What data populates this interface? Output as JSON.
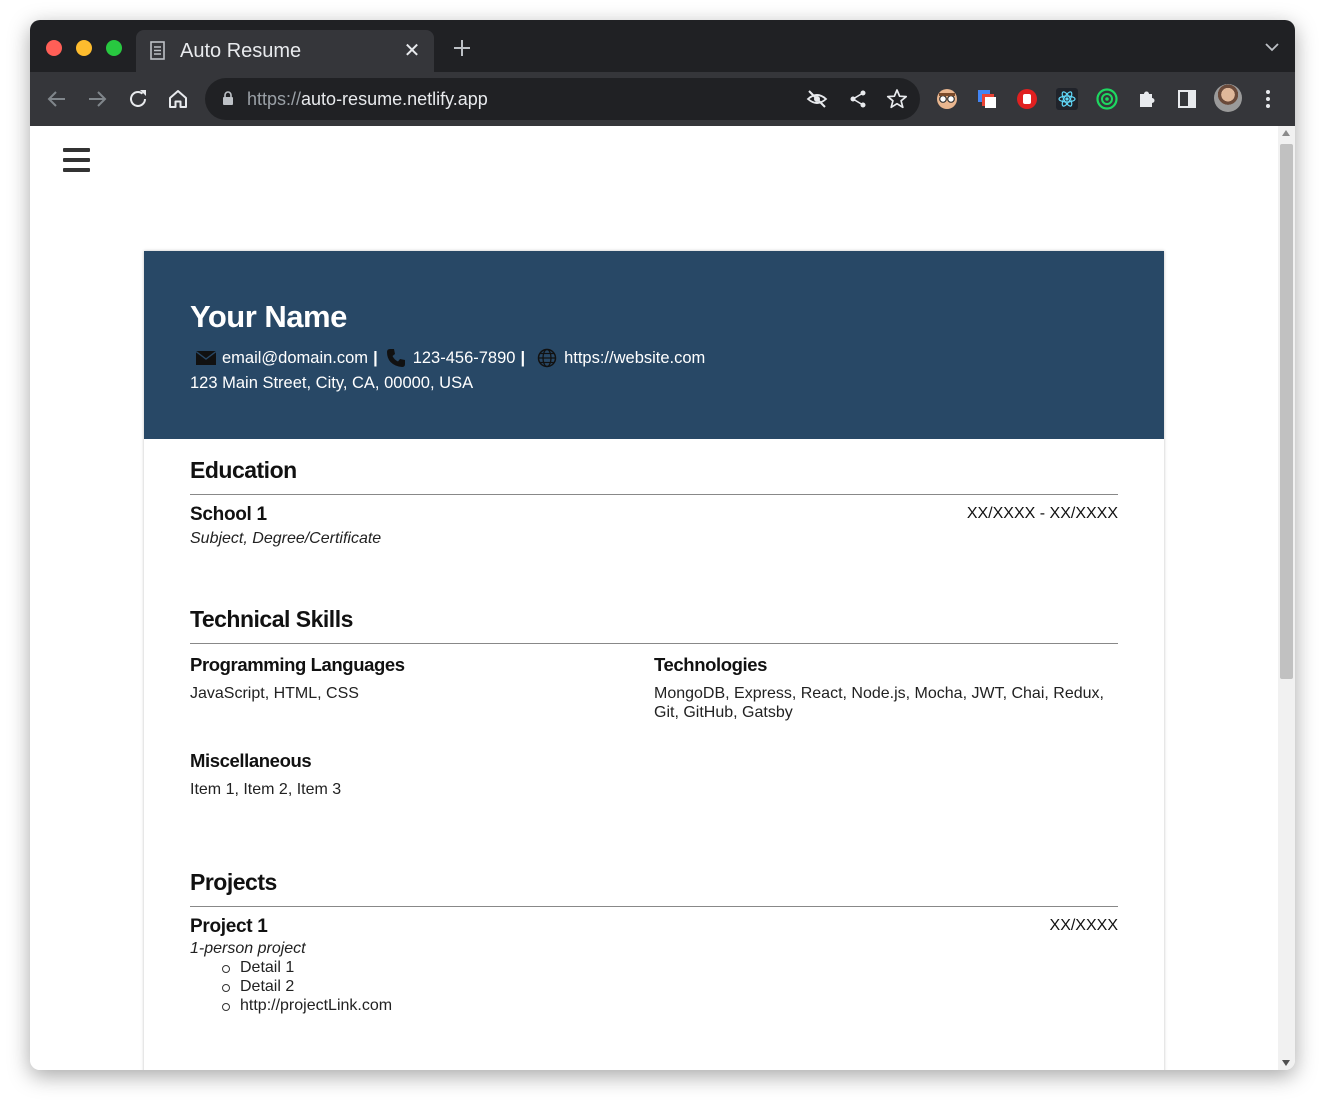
{
  "browser": {
    "tab_title": "Auto Resume",
    "tab_close": "✕",
    "url_scheme": "https://",
    "url_host": "auto-resume.netlify.app"
  },
  "resume": {
    "name": "Your Name",
    "email": "email@domain.com",
    "phone": "123-456-7890",
    "website": "https://website.com",
    "separator": "|",
    "address": "123 Main Street, City, CA, 00000, USA",
    "sections": {
      "education": {
        "title": "Education",
        "school": "School 1",
        "degree": "Subject, Degree/Certificate",
        "dates": "XX/XXXX - XX/XXXX"
      },
      "skills": {
        "title": "Technical Skills",
        "languages_label": "Programming Languages",
        "languages": "JavaScript, HTML, CSS",
        "technologies_label": "Technologies",
        "technologies": "MongoDB, Express, React, Node.js, Mocha, JWT, Chai, Redux, Git, GitHub, Gatsby",
        "misc_label": "Miscellaneous",
        "misc": "Item 1, Item 2, Item 3"
      },
      "projects": {
        "title": "Projects",
        "project_name": "Project 1",
        "project_type": "1-person project",
        "date": "XX/XXXX",
        "details": [
          "Detail 1",
          "Detail 2",
          "http://projectLink.com"
        ]
      }
    }
  },
  "colors": {
    "header_bg": "#284866",
    "chrome_dark": "#202124",
    "chrome_toolbar": "#35363a"
  },
  "icons": [
    "page-icon",
    "close-icon",
    "plus-icon",
    "chevron-down-icon",
    "back-icon",
    "forward-icon",
    "reload-icon",
    "home-icon",
    "lock-icon",
    "eye-off-icon",
    "share-icon",
    "star-icon",
    "extension-icons",
    "puzzle-icon",
    "sidepanel-icon",
    "avatar",
    "kebab-menu-icon",
    "hamburger-menu-icon",
    "envelope-icon",
    "phone-icon",
    "globe-icon"
  ]
}
